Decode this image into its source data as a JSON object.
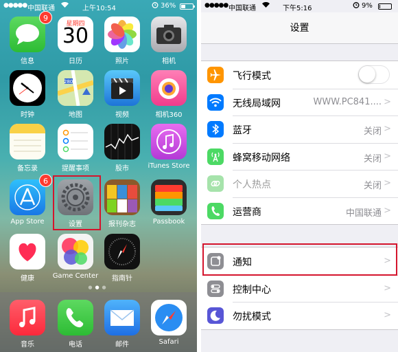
{
  "home": {
    "status": {
      "signal": "●●●●●",
      "carrier": "中国联通",
      "time": "上午10:54",
      "battery": "36%",
      "battery_level": 0.36
    },
    "apps": [
      {
        "id": "messages",
        "label": "信息",
        "badge": "9"
      },
      {
        "id": "calendar",
        "label": "日历",
        "weekday": "星期四",
        "day": "30"
      },
      {
        "id": "photos",
        "label": "照片"
      },
      {
        "id": "camera",
        "label": "相机"
      },
      {
        "id": "clock",
        "label": "时钟"
      },
      {
        "id": "maps",
        "label": "地图",
        "road": "280"
      },
      {
        "id": "videos",
        "label": "视频"
      },
      {
        "id": "camera360",
        "label": "相机360"
      },
      {
        "id": "notes",
        "label": "备忘录"
      },
      {
        "id": "reminders",
        "label": "提醒事项"
      },
      {
        "id": "stocks",
        "label": "股市"
      },
      {
        "id": "itunes",
        "label": "iTunes Store"
      },
      {
        "id": "appstore",
        "label": "App Store",
        "badge": "6"
      },
      {
        "id": "settings",
        "label": "设置"
      },
      {
        "id": "newsstand",
        "label": "报刊杂志"
      },
      {
        "id": "passbook",
        "label": "Passbook"
      },
      {
        "id": "health",
        "label": "健康"
      },
      {
        "id": "gamecenter",
        "label": "Game Center"
      },
      {
        "id": "compass",
        "label": "指南针"
      }
    ],
    "dock": [
      {
        "id": "music",
        "label": "音乐"
      },
      {
        "id": "phone",
        "label": "电话"
      },
      {
        "id": "mail",
        "label": "邮件"
      },
      {
        "id": "safari",
        "label": "Safari"
      }
    ]
  },
  "settings": {
    "status": {
      "signal": "●●●●●",
      "carrier": "中国联通",
      "time": "下午5:16",
      "battery": "9%",
      "battery_level": 0.09
    },
    "title": "设置",
    "group1": [
      {
        "id": "airplane",
        "label": "飞行模式",
        "value": "",
        "toggle": true,
        "color": "#ff9500"
      },
      {
        "id": "wifi",
        "label": "无线局域网",
        "value": "WWW.PC841....",
        "color": "#007aff"
      },
      {
        "id": "bluetooth",
        "label": "蓝牙",
        "value": "关闭",
        "color": "#007aff"
      },
      {
        "id": "cellular",
        "label": "蜂窝移动网络",
        "value": "关闭",
        "color": "#4cd964"
      },
      {
        "id": "hotspot",
        "label": "个人热点",
        "value": "关闭",
        "color": "#a6e3ab",
        "disabled": true
      },
      {
        "id": "carrier",
        "label": "运营商",
        "value": "中国联通",
        "color": "#4cd964"
      }
    ],
    "group2": [
      {
        "id": "notifications",
        "label": "通知",
        "value": "",
        "color": "#8e8e93"
      },
      {
        "id": "control-center",
        "label": "控制中心",
        "value": "",
        "color": "#8e8e93"
      },
      {
        "id": "dnd",
        "label": "勿扰模式",
        "value": "",
        "color": "#5856d6"
      }
    ]
  },
  "colors": {
    "highlight": "#d4142c"
  }
}
